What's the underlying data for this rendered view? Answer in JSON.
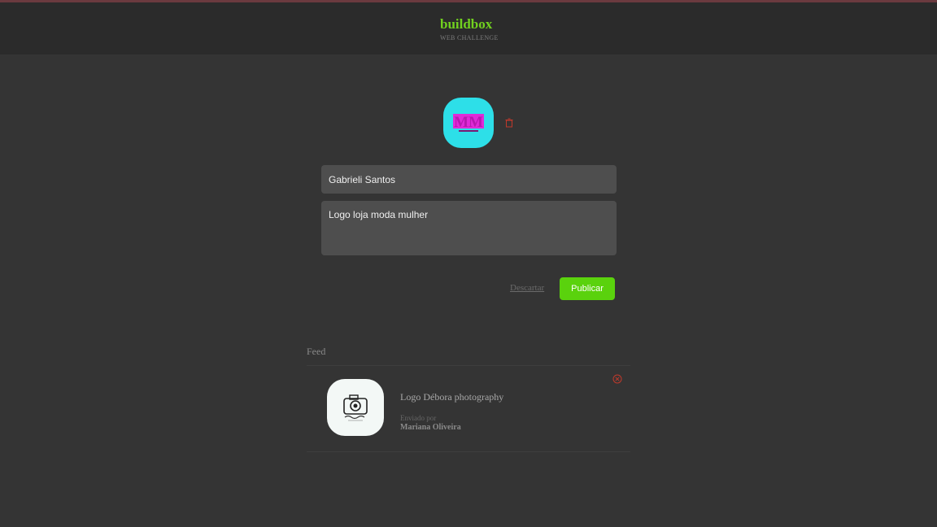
{
  "header": {
    "brand_title": "buildbox",
    "brand_subtitle": "WEB CHALLENGE"
  },
  "form": {
    "name_value": "Gabrieli Santos",
    "message_value": "Logo loja moda mulher",
    "discard_label": "Descartar",
    "publish_label": "Publicar",
    "avatar_logo_text": "MM"
  },
  "feed": {
    "label": "Feed",
    "items": [
      {
        "message": "Logo Débora photography",
        "sent_by_label": "Enviado por",
        "author": "Mariana Oliveira"
      }
    ]
  },
  "icons": {
    "remove_avatar": "trash-icon",
    "remove_post": "close-circle-icon"
  },
  "colors": {
    "accent_green": "#5ad20d",
    "brand_green": "#71d11f",
    "avatar_bg": "#2ddfe8",
    "avatar_logo": "#e02ad8",
    "danger": "#c0392b"
  }
}
